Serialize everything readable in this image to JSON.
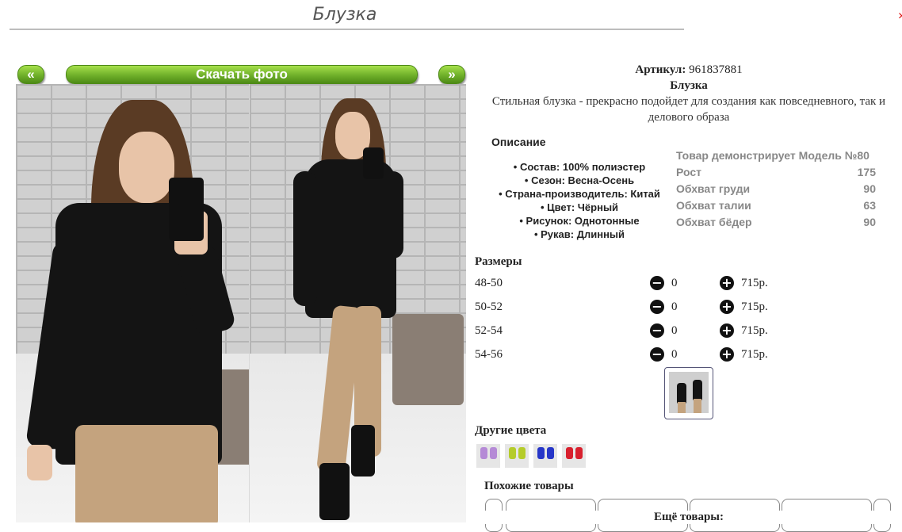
{
  "page_title": "Блузка",
  "gallery": {
    "prev_label": "«",
    "download_label": "Скачать фото",
    "next_label": "»"
  },
  "product": {
    "article_label": "Артикул:",
    "article_value": "961837881",
    "name": "Блузка",
    "short_description": "Стильная блузка - прекрасно подойдет для создания как повседневного, так и делового образа"
  },
  "description": {
    "heading": "Описание",
    "properties": [
      "• Состав: 100% полиэстер",
      "• Сезон: Весна-Осень",
      "• Страна-производитель: Китай",
      "• Цвет: Чёрный",
      "• Рисунок: Однотонные",
      "• Рукав: Длинный"
    ]
  },
  "model": {
    "heading": "Товар демонстрирует Модель №80",
    "rows": [
      {
        "label": "Рост",
        "value": "175"
      },
      {
        "label": "Обхват груди",
        "value": "90"
      },
      {
        "label": "Обхват талии",
        "value": "63"
      },
      {
        "label": "Обхват бёдер",
        "value": "90"
      }
    ]
  },
  "sizes": {
    "heading": "Размеры",
    "rows": [
      {
        "size": "48-50",
        "qty": "0",
        "price": "715р."
      },
      {
        "size": "50-52",
        "qty": "0",
        "price": "715р."
      },
      {
        "size": "52-54",
        "qty": "0",
        "price": "715р."
      },
      {
        "size": "54-56",
        "qty": "0",
        "price": "715р."
      }
    ],
    "minus_icon": "minus-circle-icon",
    "plus_icon": "plus-circle-icon"
  },
  "other_colors": {
    "heading": "Другие цвета",
    "swatches": [
      "#b58ad6",
      "#b5cc2a",
      "#2636c8",
      "#d8202e"
    ]
  },
  "similar": {
    "heading": "Похожие товары"
  },
  "more": {
    "heading": "Ещё товары:"
  },
  "colors": {
    "button_green": "#6fb02a",
    "muted_text": "#888888"
  }
}
